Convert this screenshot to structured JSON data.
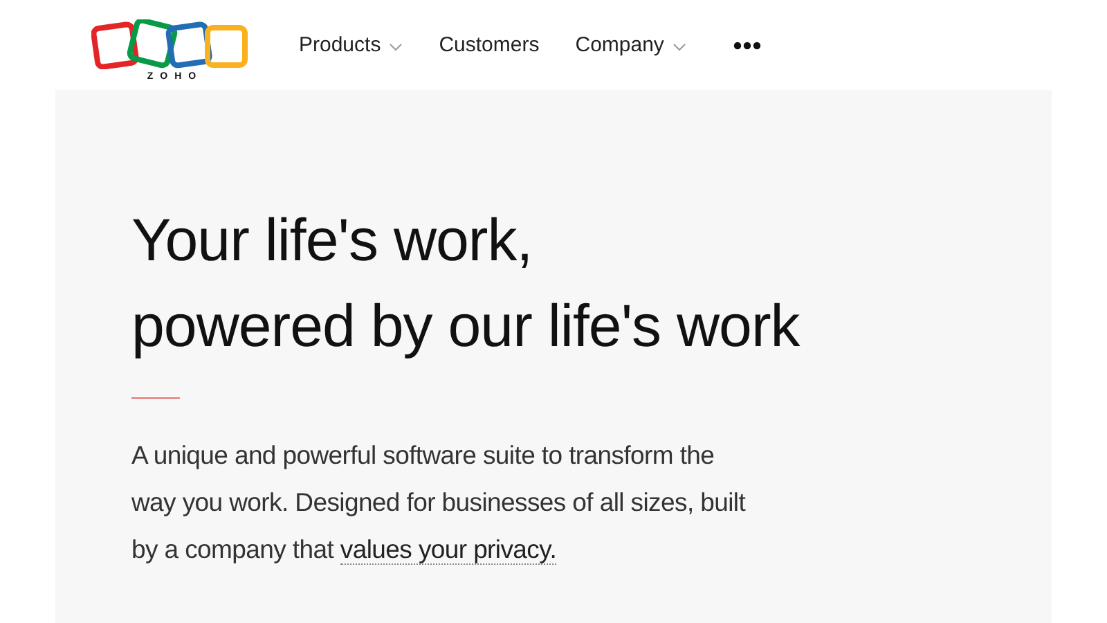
{
  "logo": {
    "wordmark": "ZOHO"
  },
  "nav": [
    {
      "label": "Products",
      "kind": "dropdown"
    },
    {
      "label": "Customers",
      "kind": "link"
    },
    {
      "label": "Company",
      "kind": "dropdown"
    }
  ],
  "hero": {
    "headline": [
      "Your life's work,",
      "powered by our life's work"
    ],
    "description": "A unique and powerful software suite to transform the way you work. Designed for businesses of all sizes, built by a company that",
    "privacy_link": "values your privacy."
  }
}
